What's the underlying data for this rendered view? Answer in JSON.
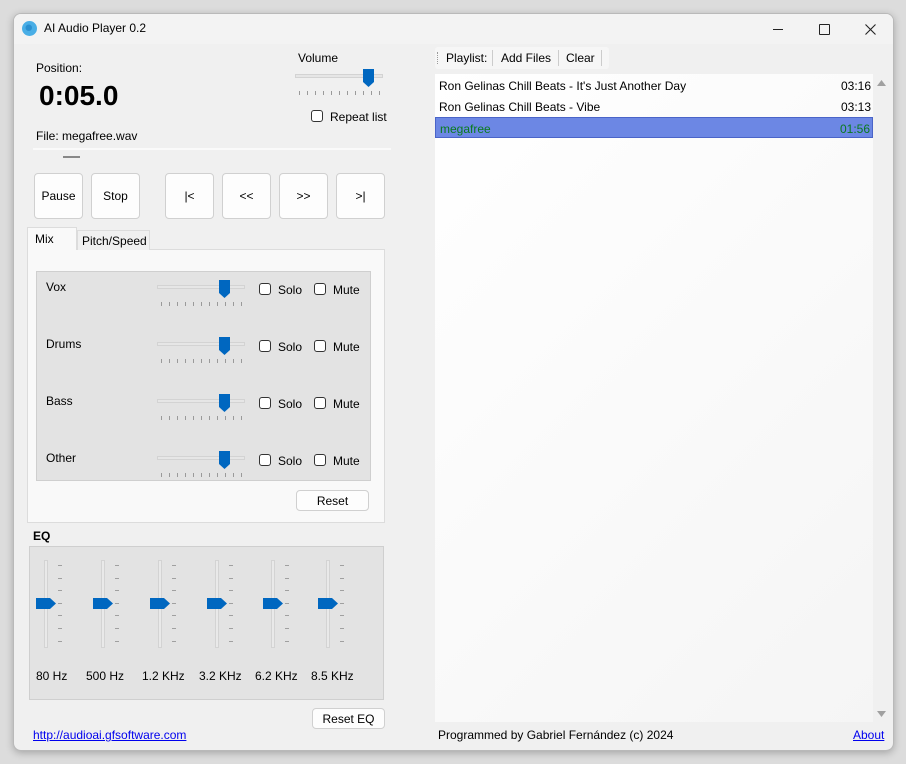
{
  "window": {
    "title": "AI Audio Player 0.2",
    "controls": {
      "minimize": "—",
      "maximize": "☐",
      "close": "✕"
    }
  },
  "position": {
    "label": "Position:",
    "value": "0:05.0",
    "file_label": "File: megafree.wav",
    "seek_fraction": 0.02
  },
  "volume": {
    "label": "Volume",
    "value_fraction": 0.88,
    "repeat_label": "Repeat list",
    "repeat_checked": false
  },
  "transport": {
    "pause": "Pause",
    "stop": "Stop",
    "first": "|<",
    "rewind": "<<",
    "forward": ">>",
    "last": ">|"
  },
  "tabs": [
    {
      "label": "Mix",
      "active": true
    },
    {
      "label": "Pitch/Speed",
      "active": false
    }
  ],
  "mix": {
    "solo_label": "Solo",
    "mute_label": "Mute",
    "reset_label": "Reset",
    "tracks": [
      {
        "name": "Vox",
        "level_fraction": 0.8,
        "solo": false,
        "mute": false
      },
      {
        "name": "Drums",
        "level_fraction": 0.8,
        "solo": false,
        "mute": false
      },
      {
        "name": "Bass",
        "level_fraction": 0.8,
        "solo": false,
        "mute": false
      },
      {
        "name": "Other",
        "level_fraction": 0.8,
        "solo": false,
        "mute": false
      }
    ]
  },
  "eq": {
    "title": "EQ",
    "reset_label": "Reset EQ",
    "bands": [
      {
        "label": "80 Hz",
        "gain_fraction": 0.5
      },
      {
        "label": "500 Hz",
        "gain_fraction": 0.5
      },
      {
        "label": "1.2 KHz",
        "gain_fraction": 0.5
      },
      {
        "label": "3.2 KHz",
        "gain_fraction": 0.5
      },
      {
        "label": "6.2 KHz",
        "gain_fraction": 0.5
      },
      {
        "label": "8.5 KHz",
        "gain_fraction": 0.5
      }
    ]
  },
  "playlist": {
    "toolbar": {
      "title": "Playlist:",
      "add_files": "Add Files",
      "clear": "Clear"
    },
    "items": [
      {
        "name": "Ron Gelinas Chill Beats - It's Just Another Day",
        "duration": "03:16",
        "selected": false
      },
      {
        "name": "Ron Gelinas Chill Beats - Vibe",
        "duration": "03:13",
        "selected": false
      },
      {
        "name": "megafree",
        "duration": "01:56",
        "selected": true
      }
    ],
    "colors": {
      "selected_bg": "#6c87e4",
      "selected_text": "#0a7a1e"
    }
  },
  "footer": {
    "website": "http://audioai.gfsoftware.com",
    "credits": "Programmed by Gabriel Fernández (c) 2024",
    "about": "About"
  },
  "colors": {
    "accent": "#0067c0",
    "link": "#0000ee"
  }
}
